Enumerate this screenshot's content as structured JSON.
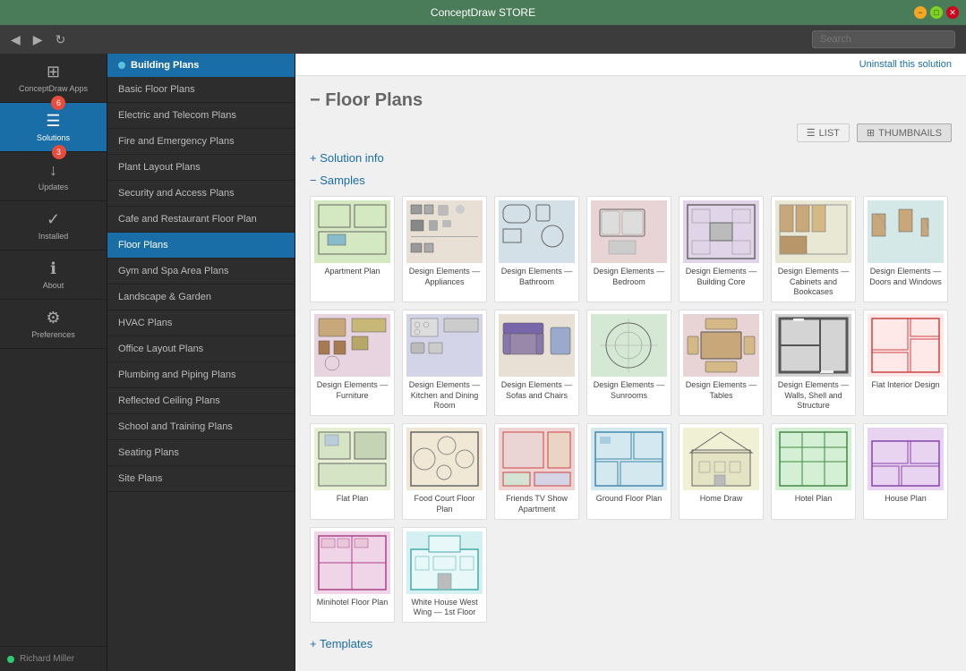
{
  "titleBar": {
    "title": "ConceptDraw STORE",
    "controls": {
      "minimize": "−",
      "maximize": "□",
      "close": "✕"
    }
  },
  "navBar": {
    "backBtn": "◀",
    "forwardBtn": "▶",
    "refreshBtn": "↻",
    "search": {
      "placeholder": "Search"
    }
  },
  "sidebar": {
    "items": [
      {
        "id": "apps",
        "icon": "⊞",
        "label": "ConceptDraw Apps",
        "active": false,
        "badge": null
      },
      {
        "id": "solutions",
        "icon": "☰",
        "label": "Solutions",
        "active": true,
        "badge": "6"
      },
      {
        "id": "updates",
        "icon": "↓",
        "label": "Updates",
        "active": false,
        "badge": "3"
      },
      {
        "id": "installed",
        "icon": "✓",
        "label": "Installed",
        "active": false,
        "badge": null
      },
      {
        "id": "about",
        "icon": "ℹ",
        "label": "About",
        "active": false,
        "badge": null
      },
      {
        "id": "preferences",
        "icon": "⚙",
        "label": "Preferences",
        "active": false,
        "badge": null
      }
    ],
    "user": {
      "name": "Richard Miller",
      "statusColor": "#2ecc71"
    }
  },
  "solutionsSidebar": {
    "header": "Building Plans",
    "items": [
      {
        "label": "Basic Floor Plans",
        "active": false
      },
      {
        "label": "Electric and Telecom Plans",
        "active": false
      },
      {
        "label": "Fire and Emergency Plans",
        "active": false
      },
      {
        "label": "Plant Layout Plans",
        "active": false
      },
      {
        "label": "Security and Access Plans",
        "active": false
      },
      {
        "label": "Cafe and Restaurant Floor Plan",
        "active": false
      },
      {
        "label": "Floor Plans",
        "active": true
      },
      {
        "label": "Gym and Spa Area Plans",
        "active": false
      },
      {
        "label": "Landscape & Garden",
        "active": false
      },
      {
        "label": "HVAC Plans",
        "active": false
      },
      {
        "label": "Office Layout Plans",
        "active": false
      },
      {
        "label": "Plumbing and Piping Plans",
        "active": false
      },
      {
        "label": "Reflected Ceiling Plans",
        "active": false
      },
      {
        "label": "School and Training Plans",
        "active": false
      },
      {
        "label": "Seating Plans",
        "active": false
      },
      {
        "label": "Site Plans",
        "active": false
      }
    ]
  },
  "mainContent": {
    "uninstallLabel": "Uninstall this solution",
    "pageTitle": "− Floor Plans",
    "viewToggle": {
      "list": "LIST",
      "thumbnails": "THUMBNAILS",
      "activeView": "thumbnails"
    },
    "solutionInfo": {
      "label": "+ Solution info"
    },
    "samples": {
      "label": "− Samples",
      "items": [
        {
          "id": "apartment",
          "label": "Apartment Plan",
          "bgClass": "fp-apartment"
        },
        {
          "id": "appliances",
          "label": "Design Elements — Appliances",
          "bgClass": "fp-appliances"
        },
        {
          "id": "bathroom",
          "label": "Design Elements — Bathroom",
          "bgClass": "fp-bathroom"
        },
        {
          "id": "bedroom",
          "label": "Design Elements — Bedroom",
          "bgClass": "fp-bedroom"
        },
        {
          "id": "building-core",
          "label": "Design Elements — Building Core",
          "bgClass": "fp-building"
        },
        {
          "id": "cabinets",
          "label": "Design Elements — Cabinets and Bookcases",
          "bgClass": "fp-cabinets"
        },
        {
          "id": "doors",
          "label": "Design Elements — Doors and Windows",
          "bgClass": "fp-doors"
        },
        {
          "id": "furniture",
          "label": "Design Elements — Furniture",
          "bgClass": "fp-furniture"
        },
        {
          "id": "kitchen",
          "label": "Design Elements — Kitchen and Dining Room",
          "bgClass": "fp-kitchen"
        },
        {
          "id": "sofas",
          "label": "Design Elements — Sofas and Chairs",
          "bgClass": "fp-sofas"
        },
        {
          "id": "sunrooms",
          "label": "Design Elements — Sunrooms",
          "bgClass": "fp-sunrooms"
        },
        {
          "id": "tables",
          "label": "Design Elements — Tables",
          "bgClass": "fp-tables"
        },
        {
          "id": "walls",
          "label": "Design Elements — Walls, Shell and Structure",
          "bgClass": "fp-walls"
        },
        {
          "id": "flat-interior",
          "label": "Flat Interior Design",
          "bgClass": "fp-flat-interior"
        },
        {
          "id": "flat-plan",
          "label": "Flat Plan",
          "bgClass": "fp-flat-plan"
        },
        {
          "id": "food-court",
          "label": "Food Court Floor Plan",
          "bgClass": "fp-food-court"
        },
        {
          "id": "friends",
          "label": "Friends TV Show Apartment",
          "bgClass": "fp-friends"
        },
        {
          "id": "ground",
          "label": "Ground Floor Plan",
          "bgClass": "fp-ground"
        },
        {
          "id": "home-draw",
          "label": "Home Draw",
          "bgClass": "fp-home"
        },
        {
          "id": "hotel-plan",
          "label": "Hotel Plan",
          "bgClass": "fp-hotel"
        },
        {
          "id": "house-plan",
          "label": "House Plan",
          "bgClass": "fp-house"
        },
        {
          "id": "minihotel",
          "label": "Minihotel Floor Plan",
          "bgClass": "fp-minihotel"
        },
        {
          "id": "whitehouse",
          "label": "White House West Wing — 1st Floor",
          "bgClass": "fp-whitehouse"
        }
      ]
    },
    "templates": {
      "label": "+ Templates"
    }
  }
}
